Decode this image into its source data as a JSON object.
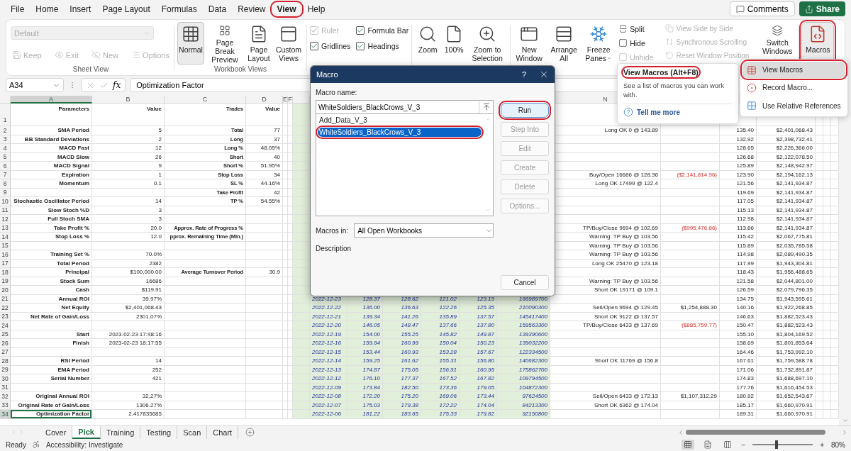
{
  "menu_tabs": [
    {
      "label": "File",
      "selected": false,
      "circled": false
    },
    {
      "label": "Home",
      "selected": false,
      "circled": false
    },
    {
      "label": "Insert",
      "selected": false,
      "circled": false
    },
    {
      "label": "Page Layout",
      "selected": false,
      "circled": false
    },
    {
      "label": "Formulas",
      "selected": false,
      "circled": false
    },
    {
      "label": "Data",
      "selected": false,
      "circled": false
    },
    {
      "label": "Review",
      "selected": false,
      "circled": false
    },
    {
      "label": "View",
      "selected": true,
      "circled": true
    },
    {
      "label": "Help",
      "selected": false,
      "circled": false
    }
  ],
  "top_buttons": {
    "comments": "Comments",
    "share": "Share"
  },
  "ribbon": {
    "sheet_view": {
      "dropdown": "Default",
      "buttons": [
        {
          "label": "Keep",
          "disabled": true
        },
        {
          "label": "Exit",
          "disabled": true
        },
        {
          "label": "New",
          "disabled": true
        },
        {
          "label": "Options",
          "disabled": true
        }
      ],
      "label": "Sheet View"
    },
    "workbook_views": {
      "buttons": [
        {
          "label": "Normal",
          "selected": true
        },
        {
          "label": "Page Break Preview",
          "selected": false
        },
        {
          "label": "Page Layout",
          "selected": false
        },
        {
          "label": "Custom Views",
          "selected": false
        }
      ],
      "label": "Workbook Views"
    },
    "show": [
      {
        "label": "Ruler",
        "checked": true,
        "disabled": true
      },
      {
        "label": "Formula Bar",
        "checked": true,
        "disabled": false
      },
      {
        "label": "Gridlines",
        "checked": true,
        "disabled": false
      },
      {
        "label": "Headings",
        "checked": true,
        "disabled": false
      }
    ],
    "zoom": [
      {
        "label": "Zoom"
      },
      {
        "label": "100%"
      },
      {
        "label": "Zoom to Selection"
      }
    ],
    "window_large": [
      {
        "label": "New Window",
        "dropdown": false
      },
      {
        "label": "Arrange All",
        "dropdown": false
      },
      {
        "label": "Freeze Panes",
        "dropdown": true
      }
    ],
    "window_small": [
      {
        "label": "Split",
        "disabled": false
      },
      {
        "label": "Hide",
        "disabled": false
      },
      {
        "label": "Unhide",
        "disabled": true
      }
    ],
    "window_compare": [
      {
        "label": "View Side by Side",
        "disabled": true
      },
      {
        "label": "Synchronous Scrolling",
        "disabled": true
      },
      {
        "label": "Reset Window Position",
        "disabled": true
      }
    ],
    "switch_windows": {
      "label": "Switch Windows",
      "dropdown": true
    },
    "macros": {
      "label": "Macros",
      "circled": true
    }
  },
  "formula_bar": {
    "name_box": "A34",
    "fx": "fx",
    "value": "Optimization Factor"
  },
  "sheet": {
    "column_headers": [
      {
        "label": "A",
        "selected": true
      },
      {
        "label": "B",
        "selected": false
      },
      {
        "label": "C",
        "selected": false
      },
      {
        "label": "D",
        "selected": false
      },
      {
        "label": "E",
        "selected": false
      },
      {
        "label": "F",
        "selected": false
      },
      {
        "label": "N",
        "selected": false
      }
    ],
    "rows": [
      {
        "number": "1",
        "kind": "header",
        "selected": false,
        "cells": {
          "A": "Parameters",
          "B": "Value",
          "C": "Trades",
          "D": "Value"
        }
      },
      {
        "number": "2",
        "kind": "data",
        "selected": false,
        "cells": {
          "A": "SMA Period",
          "B": "5",
          "C": "Total",
          "D": "77",
          "N": "Long OK 0 @ 143.89",
          "P": "135.40",
          "Q": "$2,401,068.43"
        }
      },
      {
        "number": "3",
        "kind": "data",
        "selected": false,
        "cells": {
          "A": "BB Standard Deviations",
          "B": "2",
          "C": "Long",
          "D": "37",
          "P": "132.92",
          "Q": "$2,398,732.41"
        }
      },
      {
        "number": "4",
        "kind": "data",
        "selected": false,
        "cells": {
          "A": "MACD Fast",
          "B": "12",
          "C": "Long %",
          "D": "48.05%",
          "P": "128.65",
          "Q": "$2,226,366.00"
        }
      },
      {
        "number": "5",
        "kind": "data",
        "selected": false,
        "cells": {
          "A": "MACD Slow",
          "B": "26",
          "C": "Short",
          "D": "40",
          "P": "126.68",
          "Q": "$2,122,078.50"
        }
      },
      {
        "number": "6",
        "kind": "data",
        "selected": false,
        "cells": {
          "A": "MACD Signal",
          "B": "9",
          "C": "Short %",
          "D": "51.95%",
          "P": "125.89",
          "Q": "$2,148,942.97"
        }
      },
      {
        "number": "7",
        "kind": "data",
        "selected": false,
        "cells": {
          "A": "Expiration",
          "B": "1",
          "C": "Stop Loss",
          "D": "34",
          "N": "Buy/Open 16686 @ 128.36",
          "O": {
            "text": "($2,141,814.96)",
            "negative": true
          },
          "P": "123.90",
          "Q": "$2,194,162.13"
        }
      },
      {
        "number": "8",
        "kind": "data",
        "selected": false,
        "cells": {
          "A": "Momentum",
          "B": "0.1",
          "C": "SL %",
          "D": "44.16%",
          "N": "Long OK 17499 @ 122.4",
          "P": "121.56",
          "Q": "$2,141,934.87"
        }
      },
      {
        "number": "9",
        "kind": "data",
        "selected": false,
        "cells": {
          "C": "Take Profit",
          "D": "42",
          "P": "119.69",
          "Q": "$2,141,934.87"
        }
      },
      {
        "number": "10",
        "kind": "data",
        "selected": false,
        "cells": {
          "A": "Stochastic Oscillator Period",
          "B": "14",
          "C": "TP %",
          "D": "54.55%",
          "P": "117.05",
          "Q": "$2,141,934.87"
        }
      },
      {
        "number": "11",
        "kind": "data",
        "selected": false,
        "cells": {
          "A": "Slow Stoch %D",
          "B": "3",
          "P": "115.13",
          "Q": "$2,141,934.87"
        }
      },
      {
        "number": "12",
        "kind": "data",
        "selected": false,
        "cells": {
          "A": "Full Stoch SMA",
          "B": "3",
          "P": "112.98",
          "Q": "$2,141,934.87"
        }
      },
      {
        "number": "13",
        "kind": "data",
        "selected": false,
        "cells": {
          "A": "Take Profit %",
          "B": "20.0",
          "C": "Approx. Rate of Progress %",
          "N": "TP/Buy/Close 9694 @ 102.69",
          "O": {
            "text": "($995,476.86)",
            "negative": true
          },
          "P": "113.66",
          "Q": "$2,141,934.87"
        }
      },
      {
        "number": "14",
        "kind": "data",
        "selected": false,
        "cells": {
          "A": "Stop Loss %",
          "B": "12.0",
          "C": "pprox. Remaining Time (Min.)",
          "N": "Warning: TP Buy @ 103.56",
          "P": "115.42",
          "Q": "$2,067,775.81"
        }
      },
      {
        "number": "15",
        "kind": "data",
        "selected": false,
        "cells": {
          "N": "Warning: TP Buy @ 103.56",
          "P": "115.89",
          "Q": "$2,035,785.58"
        }
      },
      {
        "number": "16",
        "kind": "data",
        "selected": false,
        "cells": {
          "A": "Training Set %",
          "B": "70.0%",
          "N": "Warning: TP Buy @ 103.56",
          "P": "114.98",
          "Q": "$2,089,490.35"
        }
      },
      {
        "number": "17",
        "kind": "data",
        "selected": false,
        "cells": {
          "A": "Total Period",
          "B": "2382",
          "N": "Long OK 25470 @ 123.18",
          "P": "117.99",
          "Q": "$1,943,304.81"
        }
      },
      {
        "number": "18",
        "kind": "data",
        "selected": false,
        "cells": {
          "A": "Principal",
          "B": "$100,000.00",
          "C": "Average Turnover Period",
          "D": "30.9",
          "P": "118.43",
          "Q": "$1,956,488.65"
        }
      },
      {
        "number": "19",
        "kind": "data",
        "selected": false,
        "cells": {
          "A": "Stock Sum",
          "B": "16686",
          "N": "Warning: TP Buy @ 103.56",
          "P": "121.58",
          "Q": "$2,044,801.00"
        }
      },
      {
        "number": "20",
        "kind": "data",
        "selected": false,
        "cells": {
          "A": "Cash",
          "B": "$119.91",
          "N": "Short OK 19171 @ 109.1",
          "P": "126.59",
          "Q": "$2,079,796.35"
        }
      },
      {
        "number": "21",
        "kind": "data",
        "selected": false,
        "cells": {
          "A": "Annual ROI",
          "B": "39.97%",
          "H": "2022-12-23",
          "I": "128.37",
          "J": "128.62",
          "K": "121.02",
          "L": "123.15",
          "M": "166989700",
          "P": "134.75",
          "Q": "$1,943,595.61"
        }
      },
      {
        "number": "22",
        "kind": "data",
        "selected": false,
        "cells": {
          "A": "Net Equity",
          "B": "$2,401,068.43",
          "H": "2022-12-22",
          "I": "136.00",
          "J": "136.63",
          "K": "122.26",
          "L": "125.35",
          "M": "210090300",
          "N": "Sell/Open 9694 @ 129.45",
          "O": {
            "text": "$1,254,888.30",
            "negative": false
          },
          "P": "140.16",
          "Q": "$1,922,268.85"
        }
      },
      {
        "number": "23",
        "kind": "data",
        "selected": false,
        "cells": {
          "A": "Net Rate of Gain/Loss",
          "B": "2301.07%",
          "H": "2022-12-21",
          "I": "139.34",
          "J": "141.26",
          "K": "135.89",
          "L": "137.57",
          "M": "145417400",
          "N": "Short OK 9122 @ 137.57",
          "P": "146.63",
          "Q": "$1,882,523.43"
        }
      },
      {
        "number": "24",
        "kind": "data",
        "selected": false,
        "cells": {
          "H": "2022-12-20",
          "I": "146.05",
          "J": "148.47",
          "K": "137.66",
          "L": "137.80",
          "M": "159563300",
          "N": "TP/Buy/Close 6433 @ 137.69",
          "O": {
            "text": "($885,759.77)",
            "negative": true
          },
          "P": "150.47",
          "Q": "$1,882,523.43"
        }
      },
      {
        "number": "25",
        "kind": "data",
        "selected": false,
        "cells": {
          "A": "Start",
          "B": "2023-02-23 17:48:16",
          "H": "2022-12-19",
          "I": "154.00",
          "J": "155.25",
          "K": "145.82",
          "L": "149.87",
          "M": "139390600",
          "P": "155.10",
          "Q": "$1,804,169.52"
        }
      },
      {
        "number": "26",
        "kind": "data",
        "selected": false,
        "cells": {
          "A": "Finish",
          "B": "2023-02-23 18:17:55",
          "H": "2022-12-16",
          "I": "159.64",
          "J": "160.99",
          "K": "150.04",
          "L": "150.23",
          "M": "139032200",
          "P": "158.69",
          "Q": "$1,801,853.64"
        }
      },
      {
        "number": "27",
        "kind": "data",
        "selected": false,
        "cells": {
          "H": "2022-12-15",
          "I": "153.44",
          "J": "160.93",
          "K": "153.28",
          "L": "157.67",
          "M": "122334500",
          "P": "164.46",
          "Q": "$1,753,992.10"
        }
      },
      {
        "number": "28",
        "kind": "data",
        "selected": false,
        "cells": {
          "A": "RSI Period",
          "B": "14",
          "H": "2022-12-14",
          "I": "159.25",
          "J": "161.62",
          "K": "155.31",
          "L": "156.80",
          "M": "140682300",
          "N": "Short OK 11769 @ 156.8",
          "P": "167.61",
          "Q": "$1,759,588.78"
        }
      },
      {
        "number": "29",
        "kind": "data",
        "selected": false,
        "cells": {
          "A": "EMA Period",
          "B": "252",
          "H": "2022-12-13",
          "I": "174.87",
          "J": "175.05",
          "K": "156.91",
          "L": "160.95",
          "M": "175862700",
          "P": "171.06",
          "Q": "$1,732,891.87"
        }
      },
      {
        "number": "30",
        "kind": "data",
        "selected": false,
        "cells": {
          "A": "Serial Number",
          "B": "421",
          "H": "2022-12-12",
          "I": "176.10",
          "J": "177.37",
          "K": "167.52",
          "L": "167.82",
          "M": "109794500",
          "P": "174.83",
          "Q": "$1,688,697.10"
        }
      },
      {
        "number": "31",
        "kind": "data",
        "selected": false,
        "cells": {
          "H": "2022-12-09",
          "I": "173.84",
          "J": "182.50",
          "K": "173.36",
          "L": "179.05",
          "M": "104872300",
          "P": "177.76",
          "Q": "$1,616,454.53"
        }
      },
      {
        "number": "32",
        "kind": "data",
        "selected": false,
        "cells": {
          "A": "Original Annual ROI",
          "B": "32.27%",
          "H": "2022-12-08",
          "I": "172.20",
          "J": "175.20",
          "K": "169.06",
          "L": "173.44",
          "M": "97624500",
          "N": "Sell/Open 6433 @ 172.13",
          "O": {
            "text": "$1,107,312.29",
            "negative": false
          },
          "P": "180.92",
          "Q": "$1,652,543.67"
        }
      },
      {
        "number": "33",
        "kind": "data",
        "selected": false,
        "cells": {
          "A": "Original Rate of Gain/Loss",
          "B": "1306.27%",
          "H": "2022-12-07",
          "I": "175.03",
          "J": "179.38",
          "K": "172.22",
          "L": "174.04",
          "M": "84213300",
          "N": "Short OK 6362 @ 174.04",
          "P": "185.17",
          "Q": "$1,660,970.91"
        }
      },
      {
        "number": "34",
        "kind": "data",
        "selected": true,
        "cells": {
          "A": "Optimization Factor",
          "B": "2.417835685",
          "H": "2022-12-06",
          "I": "181.22",
          "J": "183.65",
          "K": "175.33",
          "L": "179.82",
          "M": "92150800",
          "P": "189.31",
          "Q": "$1,660,970.91"
        }
      }
    ]
  },
  "dialog": {
    "title": "Macro",
    "help": "?",
    "name_label": "Macro name:",
    "name_value": "WhiteSoldiers_BlackCrows_V_3",
    "macros": [
      {
        "label": "Add_Data_V_3",
        "selected": false,
        "circled": false
      },
      {
        "label": "WhiteSoldiers_BlackCrows_V_3",
        "selected": true,
        "circled": true
      }
    ],
    "buttons": [
      {
        "label": "Run",
        "disabled": false,
        "circled": true
      },
      {
        "label": "Step Into",
        "disabled": true,
        "circled": false
      },
      {
        "label": "Edit",
        "disabled": true,
        "circled": false
      },
      {
        "label": "Create",
        "disabled": true,
        "circled": false
      },
      {
        "label": "Delete",
        "disabled": true,
        "circled": false
      },
      {
        "label": "Options...",
        "disabled": true,
        "circled": false
      }
    ],
    "macros_in_label": "Macros in:",
    "macros_in_value": "All Open Workbooks",
    "description_label": "Description",
    "cancel": "Cancel"
  },
  "tooltip": {
    "title": "View Macros (Alt+F8)",
    "title_circled": true,
    "text": "See a list of macros you can work with.",
    "link": "Tell me more"
  },
  "macros_menu": [
    {
      "label": "View Macros",
      "highlighted": true,
      "circled": true
    },
    {
      "label": "Record Macro...",
      "highlighted": false,
      "circled": false
    },
    {
      "label": "Use Relative References",
      "highlighted": false,
      "circled": false
    }
  ],
  "sheet_tabs": [
    {
      "label": "Cover",
      "selected": false
    },
    {
      "label": "Pick",
      "selected": true
    },
    {
      "label": "Training",
      "selected": false
    },
    {
      "label": "Testing",
      "selected": false
    },
    {
      "label": "Scan",
      "selected": false
    },
    {
      "label": "Chart",
      "selected": false
    }
  ],
  "status_bar": {
    "ready": "Ready",
    "accessibility": "Accessibility: Investigate",
    "views": [
      {
        "selected": true
      },
      {
        "selected": false
      },
      {
        "selected": false
      }
    ],
    "zoom_out": "−",
    "zoom_in": "+",
    "level": 0.4,
    "zoom": "80%"
  }
}
